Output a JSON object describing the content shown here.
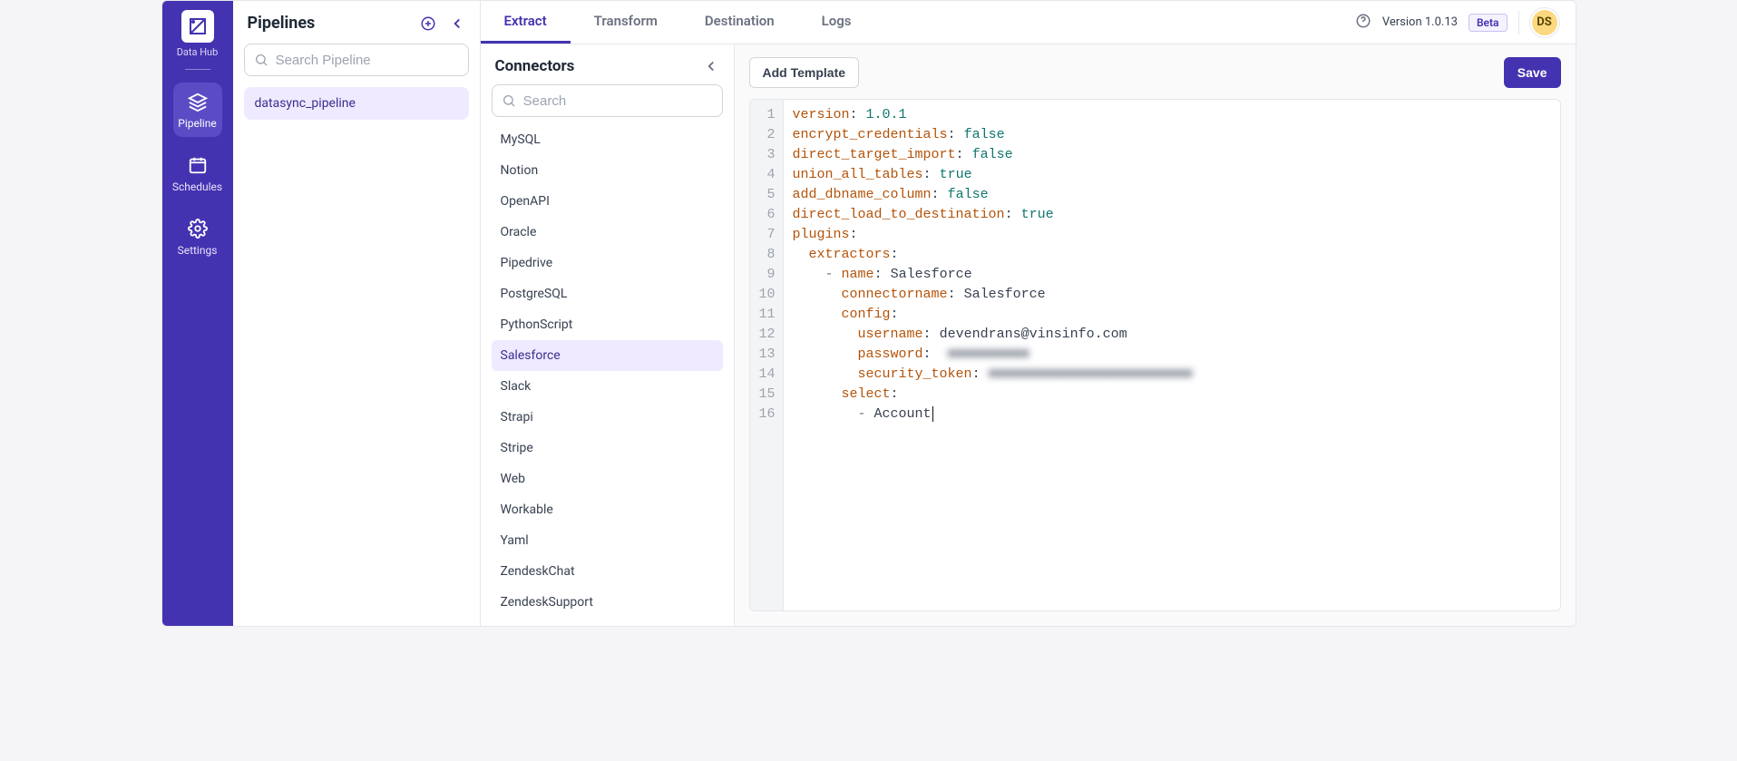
{
  "nav": {
    "brand_label": "Data Hub",
    "items": [
      {
        "label": "Pipeline"
      },
      {
        "label": "Schedules"
      },
      {
        "label": "Settings"
      }
    ]
  },
  "pipelines": {
    "title": "Pipelines",
    "search_placeholder": "Search Pipeline",
    "items": [
      {
        "name": "datasync_pipeline"
      }
    ]
  },
  "tabs": [
    "Extract",
    "Transform",
    "Destination",
    "Logs"
  ],
  "active_tab": "Extract",
  "header": {
    "version_label": "Version 1.0.13",
    "beta_label": "Beta",
    "avatar_initials": "DS"
  },
  "connectors": {
    "title": "Connectors",
    "search_placeholder": "Search",
    "selected": "Salesforce",
    "items": [
      "MySQL",
      "Notion",
      "OpenAPI",
      "Oracle",
      "Pipedrive",
      "PostgreSQL",
      "PythonScript",
      "Salesforce",
      "Slack",
      "Strapi",
      "Stripe",
      "Web",
      "Workable",
      "Yaml",
      "ZendeskChat",
      "ZendeskSupport"
    ]
  },
  "editor": {
    "add_template_label": "Add Template",
    "save_label": "Save",
    "lines": [
      [
        [
          "key",
          "version"
        ],
        [
          "plain",
          ": "
        ],
        [
          "val",
          "1.0.1"
        ]
      ],
      [
        [
          "key",
          "encrypt_credentials"
        ],
        [
          "plain",
          ": "
        ],
        [
          "val",
          "false"
        ]
      ],
      [
        [
          "key",
          "direct_target_import"
        ],
        [
          "plain",
          ": "
        ],
        [
          "val",
          "false"
        ]
      ],
      [
        [
          "key",
          "union_all_tables"
        ],
        [
          "plain",
          ": "
        ],
        [
          "val",
          "true"
        ]
      ],
      [
        [
          "key",
          "add_dbname_column"
        ],
        [
          "plain",
          ": "
        ],
        [
          "val",
          "false"
        ]
      ],
      [
        [
          "key",
          "direct_load_to_destination"
        ],
        [
          "plain",
          ": "
        ],
        [
          "val",
          "true"
        ]
      ],
      [
        [
          "key",
          "plugins"
        ],
        [
          "plain",
          ":"
        ]
      ],
      [
        [
          "plain",
          "  "
        ],
        [
          "key",
          "extractors"
        ],
        [
          "plain",
          ":"
        ]
      ],
      [
        [
          "plain",
          "    "
        ],
        [
          "dash",
          "- "
        ],
        [
          "key",
          "name"
        ],
        [
          "plain",
          ": "
        ],
        [
          "plain",
          "Salesforce"
        ]
      ],
      [
        [
          "plain",
          "      "
        ],
        [
          "key",
          "connectorname"
        ],
        [
          "plain",
          ": "
        ],
        [
          "plain",
          "Salesforce"
        ]
      ],
      [
        [
          "plain",
          "      "
        ],
        [
          "key",
          "config"
        ],
        [
          "plain",
          ":"
        ]
      ],
      [
        [
          "plain",
          "        "
        ],
        [
          "key",
          "username"
        ],
        [
          "plain",
          ": "
        ],
        [
          "plain",
          "devendrans@vinsinfo.com"
        ]
      ],
      [
        [
          "plain",
          "        "
        ],
        [
          "key",
          "password"
        ],
        [
          "plain",
          ":  "
        ],
        [
          "blur",
          "■■■■■■■■■■"
        ]
      ],
      [
        [
          "plain",
          "        "
        ],
        [
          "key",
          "security_token"
        ],
        [
          "plain",
          ": "
        ],
        [
          "blur",
          "■■■■■■■■■■■■■■■■■■■■■■■■■"
        ]
      ],
      [
        [
          "plain",
          "      "
        ],
        [
          "key",
          "select"
        ],
        [
          "plain",
          ":"
        ]
      ],
      [
        [
          "plain",
          "        "
        ],
        [
          "dash",
          "- "
        ],
        [
          "plain",
          "Account"
        ],
        [
          "cursor",
          ""
        ]
      ]
    ]
  }
}
